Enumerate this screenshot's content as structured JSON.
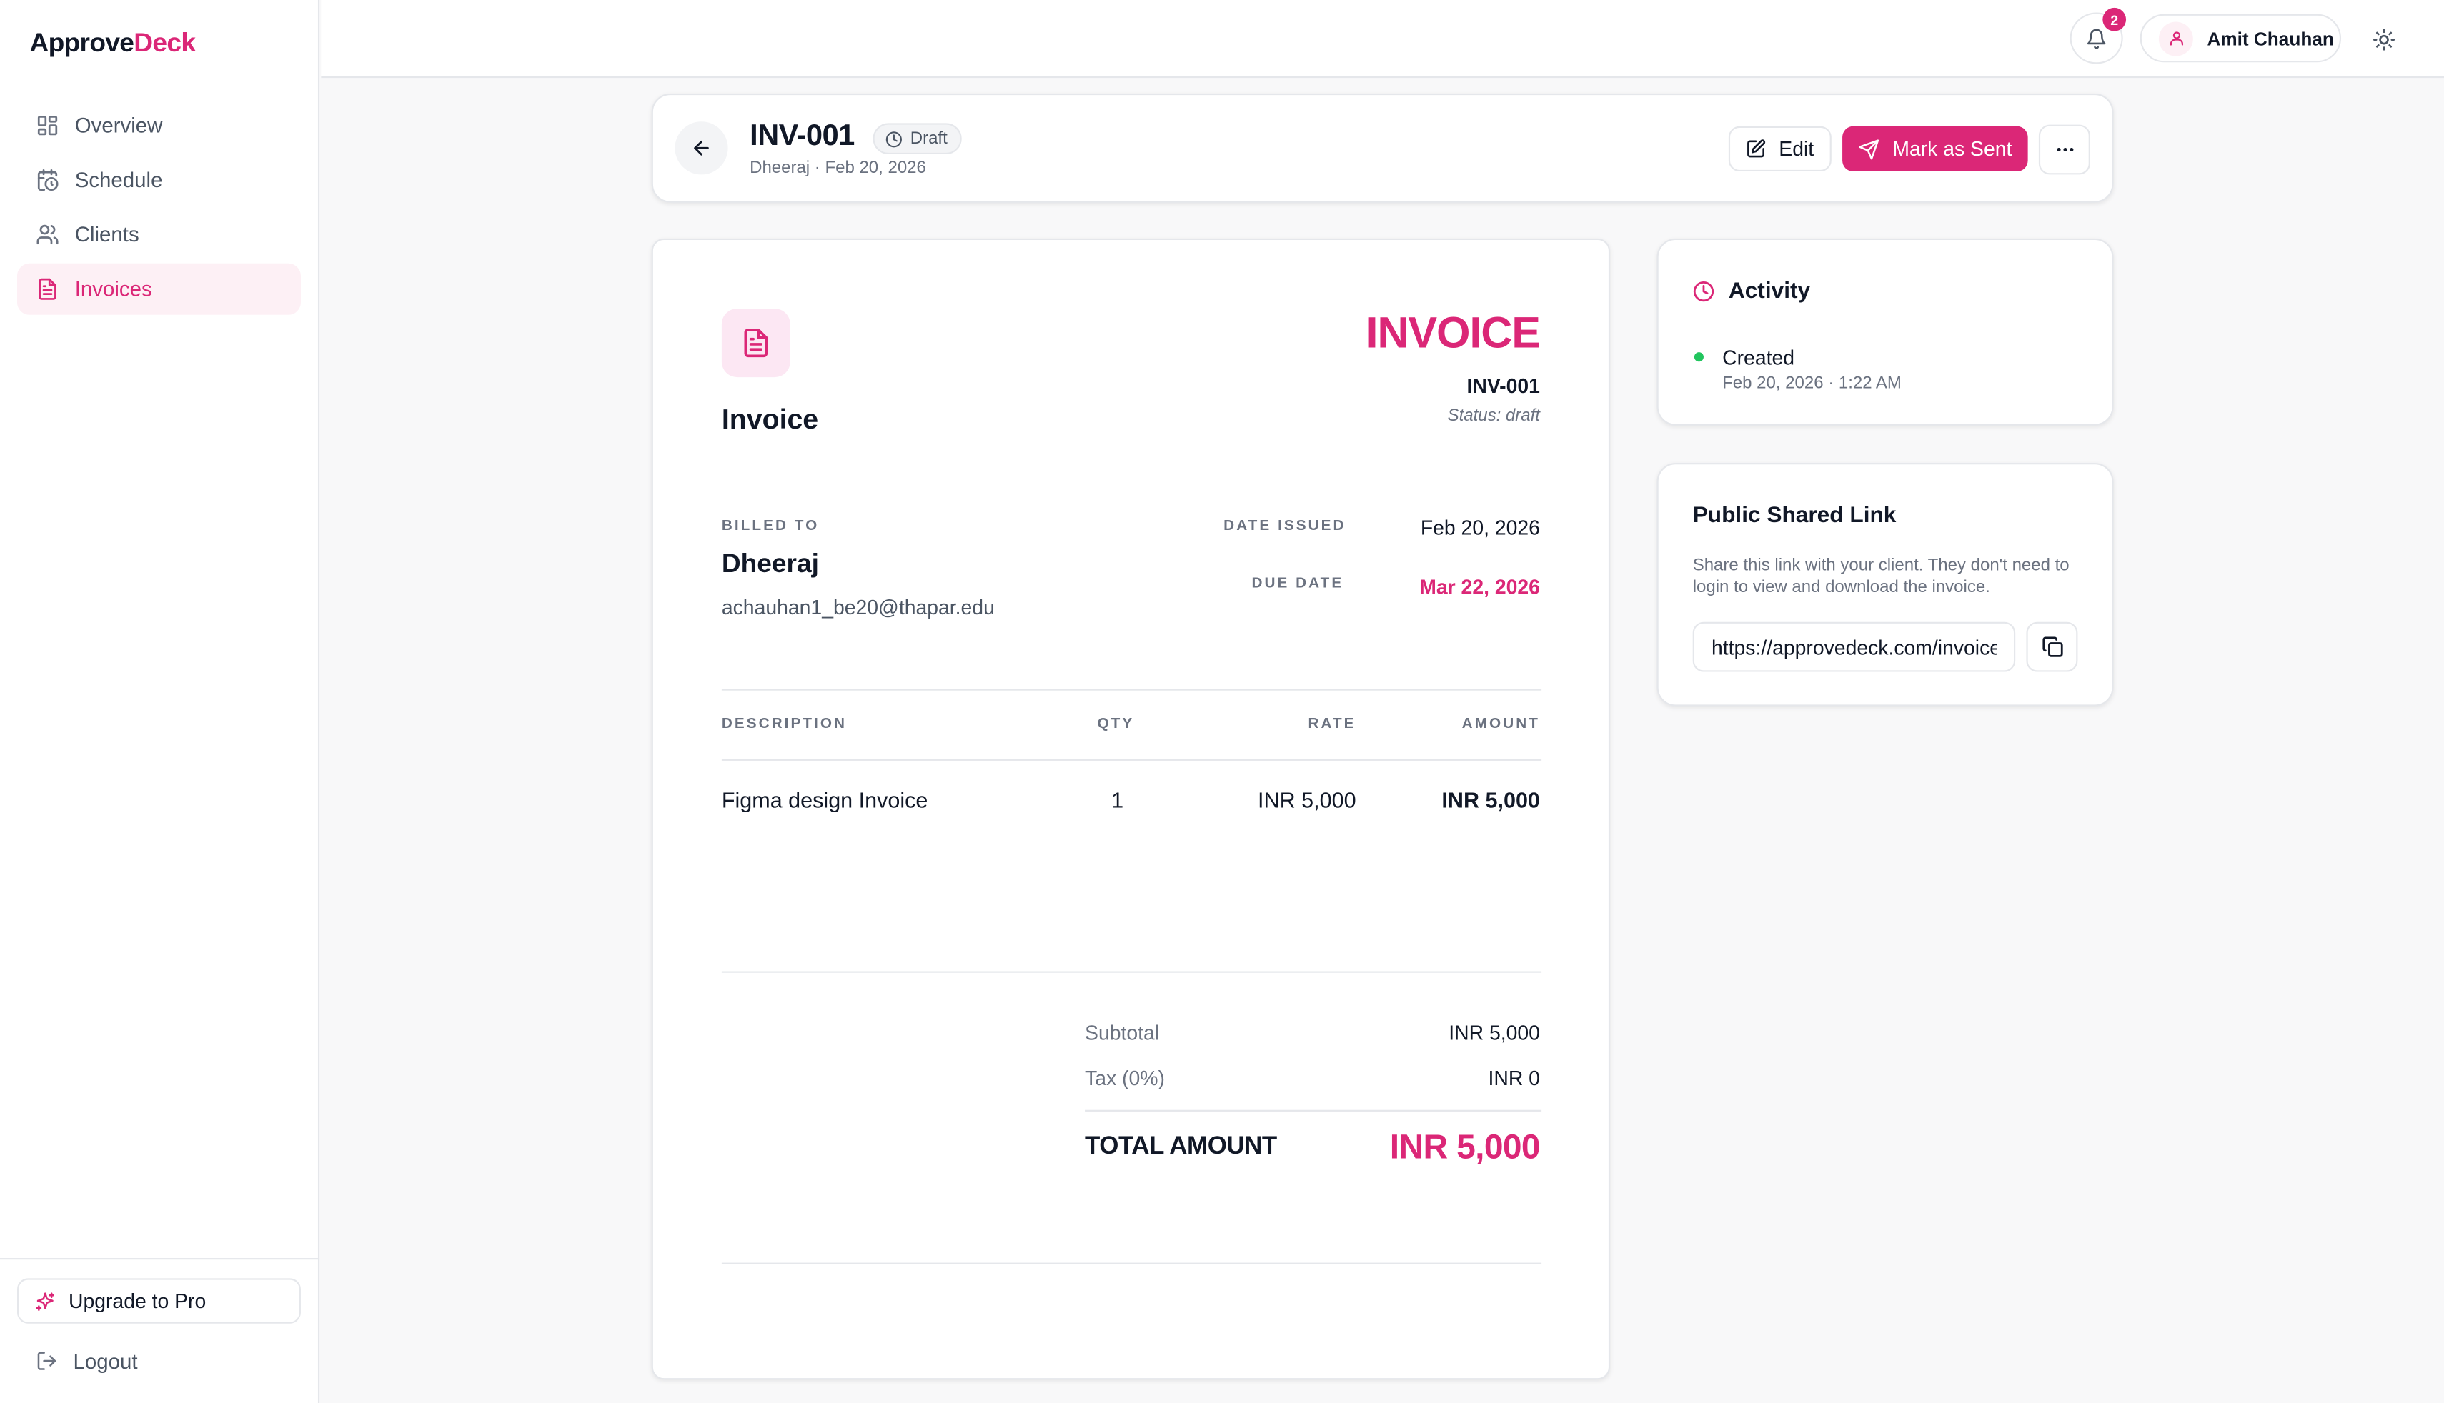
{
  "app": {
    "logo_primary": "Approve",
    "logo_accent": "Deck",
    "accent_color": "#db2777"
  },
  "sidebar": {
    "items": [
      {
        "label": "Overview",
        "icon": "grid-icon"
      },
      {
        "label": "Schedule",
        "icon": "calendar-clock-icon"
      },
      {
        "label": "Clients",
        "icon": "users-icon"
      },
      {
        "label": "Invoices",
        "icon": "file-text-icon",
        "active": true
      }
    ],
    "upgrade_label": "Upgrade to Pro",
    "logout_label": "Logout"
  },
  "topbar": {
    "notification_count": "2",
    "user_name": "Amit Chauhan"
  },
  "header": {
    "invoice_id": "INV-001",
    "status_badge": "Draft",
    "subtitle": "Dheeraj · Feb 20, 2026",
    "edit_label": "Edit",
    "mark_sent_label": "Mark as Sent"
  },
  "invoice": {
    "doc_label": "Invoice",
    "heading": "INVOICE",
    "number": "INV-001",
    "status_text": "Status: draft",
    "billed_to_label": "BILLED TO",
    "client_name": "Dheeraj",
    "client_email": "achauhan1_be20@thapar.edu",
    "date_issued_label": "DATE ISSUED",
    "date_issued": "Feb 20, 2026",
    "due_date_label": "DUE DATE",
    "due_date": "Mar 22, 2026",
    "columns": {
      "description": "DESCRIPTION",
      "qty": "QTY",
      "rate": "RATE",
      "amount": "AMOUNT"
    },
    "items": [
      {
        "description": "Figma design Invoice",
        "qty": "1",
        "rate": "INR 5,000",
        "amount": "INR 5,000"
      }
    ],
    "subtotal_label": "Subtotal",
    "subtotal": "INR 5,000",
    "tax_label": "Tax (0%)",
    "tax": "INR 0",
    "total_label": "TOTAL AMOUNT",
    "total": "INR 5,000"
  },
  "activity": {
    "title": "Activity",
    "events": [
      {
        "title": "Created",
        "time": "Feb 20, 2026 · 1:22 AM"
      }
    ]
  },
  "share": {
    "title": "Public Shared Link",
    "description": "Share this link with your client. They don't need to login to view and download the invoice.",
    "link_value": "https://approvedeck.com/invoice/"
  }
}
